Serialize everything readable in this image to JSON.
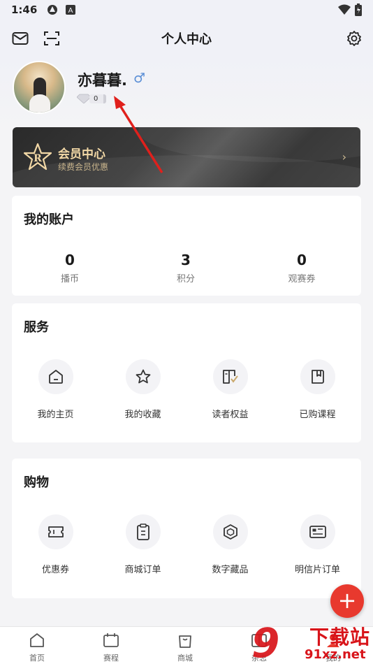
{
  "status_bar": {
    "time": "1:46"
  },
  "header": {
    "title": "个人中心"
  },
  "profile": {
    "nickname": "亦暮暮.",
    "gender_symbol": "♂",
    "level": "0"
  },
  "vip": {
    "title": "会员中心",
    "subtitle": "续费会员优惠",
    "arrow": "›"
  },
  "account": {
    "title": "我的账户",
    "stats": [
      {
        "value": "0",
        "label": "播币"
      },
      {
        "value": "3",
        "label": "积分"
      },
      {
        "value": "0",
        "label": "观赛券"
      }
    ]
  },
  "services": {
    "title": "服务",
    "items": [
      {
        "label": "我的主页",
        "icon": "home-icon"
      },
      {
        "label": "我的收藏",
        "icon": "star-icon"
      },
      {
        "label": "读者权益",
        "icon": "reader-rights-icon"
      },
      {
        "label": "已购课程",
        "icon": "purchased-course-icon"
      }
    ]
  },
  "shopping": {
    "title": "购物",
    "items": [
      {
        "label": "优惠券",
        "icon": "coupon-icon"
      },
      {
        "label": "商城订单",
        "icon": "order-clipboard-icon"
      },
      {
        "label": "数字藏品",
        "icon": "digital-collectible-icon"
      },
      {
        "label": "明信片订单",
        "icon": "postcard-icon"
      }
    ]
  },
  "fab": {
    "label": "+"
  },
  "tabbar": [
    {
      "label": "首页",
      "icon": "home-tab-icon"
    },
    {
      "label": "赛程",
      "icon": "schedule-tab-icon"
    },
    {
      "label": "商城",
      "icon": "shop-bag-tab-icon"
    },
    {
      "label": "杂志",
      "icon": "magazine-tab-icon"
    },
    {
      "label": "我的",
      "icon": "profile-tab-icon"
    }
  ],
  "watermark": {
    "text1": "下载站",
    "text2": "91xz.net",
    "numeral": "9"
  },
  "colors": {
    "accent_red": "#e8392e",
    "vip_gold": "#f2d8a6",
    "background": "#f4f4f6"
  }
}
